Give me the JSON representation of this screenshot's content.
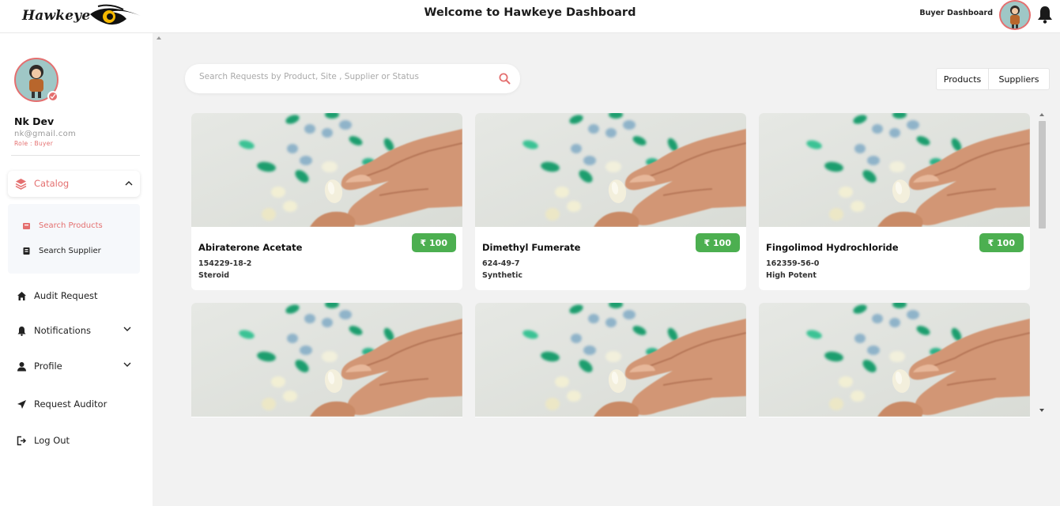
{
  "app": {
    "logo_text": "Hawkeye",
    "page_title": "Welcome to Hawkeye Dashboard",
    "role_label": "Buyer Dashboard"
  },
  "user": {
    "name": "Nk Dev",
    "email": "nk@gmail.com",
    "role": "Role : Buyer"
  },
  "sidebar": {
    "catalog_label": "Catalog",
    "catalog_sub": [
      {
        "label": "Search Products",
        "icon": "box-icon",
        "active": true
      },
      {
        "label": "Search Supplier",
        "icon": "book-icon",
        "active": false
      }
    ],
    "items": [
      {
        "label": "Audit Request",
        "icon": "home-icon"
      },
      {
        "label": "Notifications",
        "icon": "bell-icon"
      },
      {
        "label": "Profile",
        "icon": "user-icon"
      },
      {
        "label": "Request Auditor",
        "icon": "send-icon"
      },
      {
        "label": "Log Out",
        "icon": "logout-icon"
      }
    ]
  },
  "search": {
    "placeholder": "Search Requests by Product, Site , Supplier or Status",
    "value": ""
  },
  "toggle": {
    "products_label": "Products",
    "suppliers_label": "Suppliers"
  },
  "products": [
    {
      "name": "Abiraterone Acetate",
      "cas": "154229-18-2",
      "category": "Steroid",
      "price": "₹ 100"
    },
    {
      "name": "Dimethyl Fumerate",
      "cas": "624-49-7",
      "category": "Synthetic",
      "price": "₹ 100"
    },
    {
      "name": "Fingolimod Hydrochloride",
      "cas": "162359-56-0",
      "category": "High Potent",
      "price": "₹ 100"
    },
    {
      "name": "",
      "cas": "",
      "category": "",
      "price": ""
    },
    {
      "name": "",
      "cas": "",
      "category": "",
      "price": ""
    },
    {
      "name": "",
      "cas": "",
      "category": "",
      "price": ""
    }
  ],
  "colors": {
    "accent": "#e46f6f",
    "price_badge": "#4caf50",
    "background": "#f2f2f2"
  }
}
